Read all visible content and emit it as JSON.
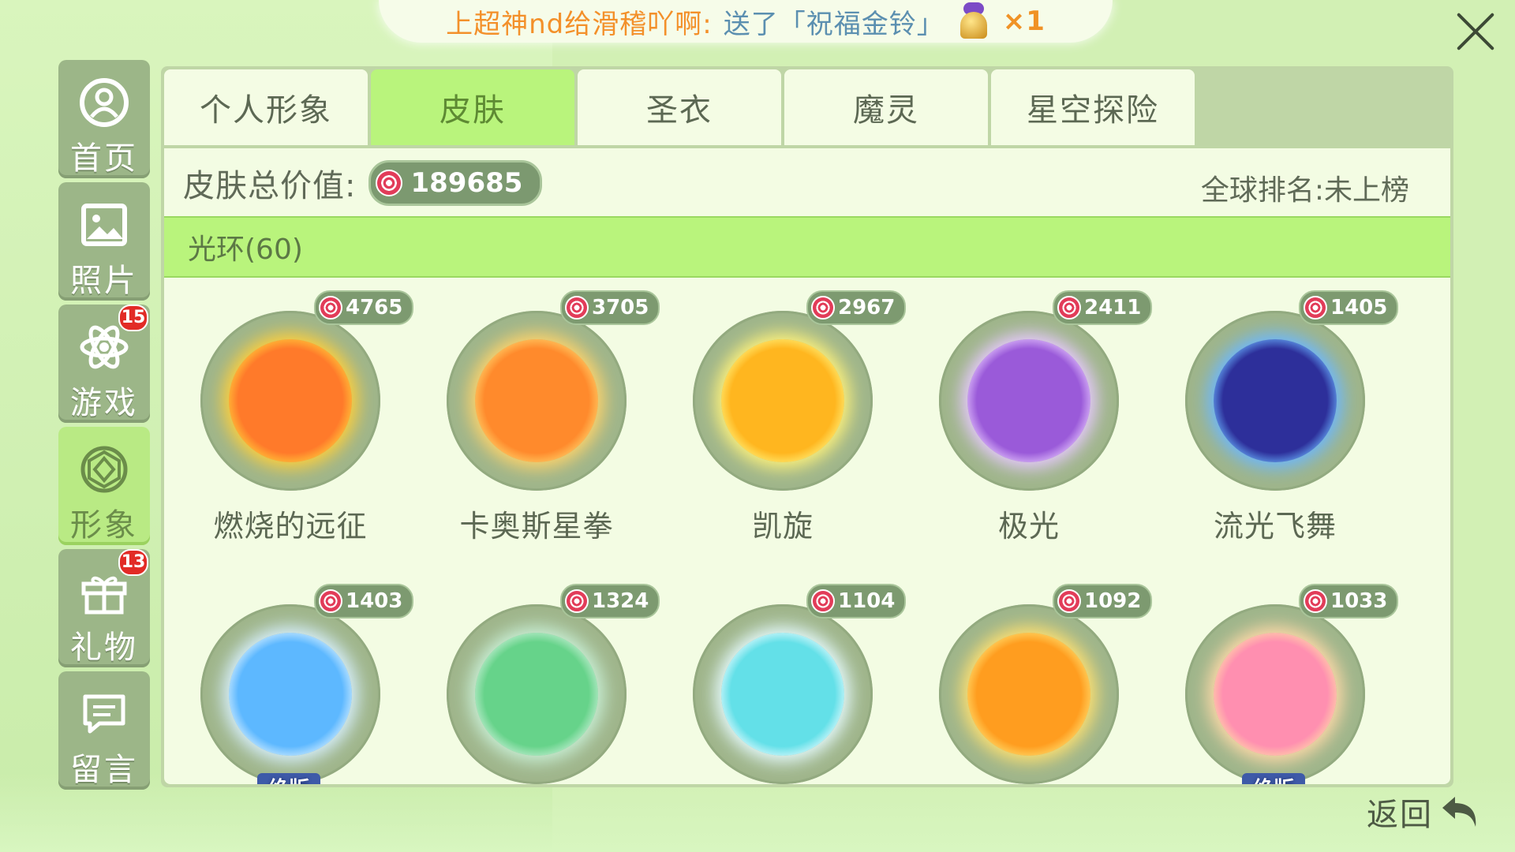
{
  "banner": {
    "sender_text": "上超神nd给滑稽吖啊:",
    "action_text": "送了「祝福金铃」",
    "gift_icon": "golden-bell-icon",
    "count": "×1"
  },
  "sidebar": {
    "items": [
      {
        "label": "首页",
        "icon": "home-profile-icon",
        "badge": ""
      },
      {
        "label": "照片",
        "icon": "photo-icon",
        "badge": ""
      },
      {
        "label": "游戏",
        "icon": "atom-game-icon",
        "badge": "15"
      },
      {
        "label": "形象",
        "icon": "diamond-icon",
        "badge": ""
      },
      {
        "label": "礼物",
        "icon": "gift-icon",
        "badge": "13"
      },
      {
        "label": "留言",
        "icon": "message-icon",
        "badge": ""
      }
    ],
    "active_index": 3
  },
  "tabs": [
    {
      "label": "个人形象"
    },
    {
      "label": "皮肤"
    },
    {
      "label": "圣衣"
    },
    {
      "label": "魔灵"
    },
    {
      "label": "星空探险"
    }
  ],
  "active_tab": 1,
  "summary": {
    "value_label": "皮肤总价值:",
    "total_value": "189685",
    "rank_text": "全球排名:未上榜"
  },
  "section": {
    "title": "光环(60)"
  },
  "items": [
    {
      "name": "燃烧的远征",
      "price": "4765",
      "color_inner": "#ff7a2a",
      "color_outer": "#ffcf3b",
      "tag": ""
    },
    {
      "name": "卡奥斯星拳",
      "price": "3705",
      "color_inner": "#ff8a2c",
      "color_outer": "#ffd36a",
      "tag": ""
    },
    {
      "name": "凯旋",
      "price": "2967",
      "color_inner": "#ffb61f",
      "color_outer": "#fff27a",
      "tag": ""
    },
    {
      "name": "极光",
      "price": "2411",
      "color_inner": "#9a5ad9",
      "color_outer": "#e7c9ff",
      "tag": ""
    },
    {
      "name": "流光飞舞",
      "price": "1405",
      "color_inner": "#2d2f9a",
      "color_outer": "#6cb7ff",
      "tag": ""
    },
    {
      "name": "",
      "price": "1403",
      "color_inner": "#5db8ff",
      "color_outer": "#d8f0ff",
      "tag": "绝版"
    },
    {
      "name": "",
      "price": "1324",
      "color_inner": "#66d38a",
      "color_outer": "#c9f0d7",
      "tag": ""
    },
    {
      "name": "",
      "price": "1104",
      "color_inner": "#63e0e8",
      "color_outer": "#e6fbff",
      "tag": ""
    },
    {
      "name": "",
      "price": "1092",
      "color_inner": "#ff9d1f",
      "color_outer": "#ffe070",
      "tag": ""
    },
    {
      "name": "",
      "price": "1033",
      "color_inner": "#ff8fb0",
      "color_outer": "#ffd9a8",
      "tag": "绝版"
    }
  ],
  "back": {
    "label": "返回",
    "icon": "return-arrow-icon"
  },
  "close": {
    "icon": "close-icon"
  }
}
